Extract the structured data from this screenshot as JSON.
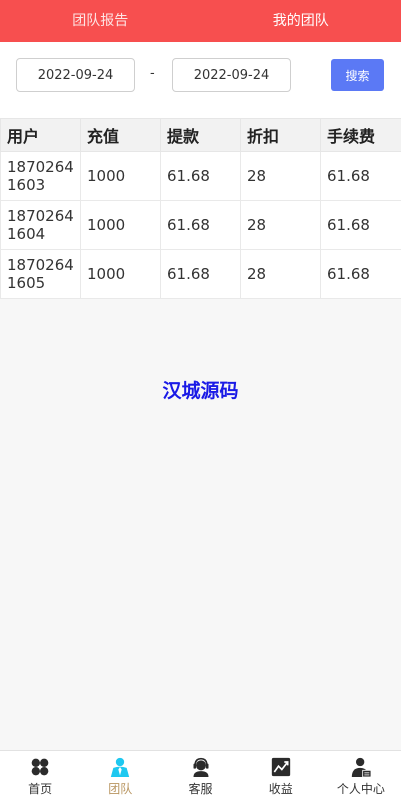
{
  "header": {
    "tabs": [
      {
        "label": "团队报告",
        "active": false
      },
      {
        "label": "我的团队",
        "active": true
      }
    ]
  },
  "filter": {
    "start_date": "2022-09-24",
    "separator": "-",
    "end_date": "2022-09-24",
    "search_label": "搜索"
  },
  "table": {
    "columns": [
      "用户",
      "充值",
      "提款",
      "折扣",
      "手续费"
    ],
    "rows": [
      [
        "18702641603",
        "1000",
        "61.68",
        "28",
        "61.68"
      ],
      [
        "18702641604",
        "1000",
        "61.68",
        "28",
        "61.68"
      ],
      [
        "18702641605",
        "1000",
        "61.68",
        "28",
        "61.68"
      ]
    ]
  },
  "watermark": "汉城源码",
  "bottom_nav": {
    "items": [
      {
        "label": "首页",
        "icon": "home-grid-icon",
        "active": false
      },
      {
        "label": "团队",
        "icon": "team-person-icon",
        "active": true
      },
      {
        "label": "客服",
        "icon": "support-headset-icon",
        "active": false
      },
      {
        "label": "收益",
        "icon": "earnings-chart-icon",
        "active": false
      },
      {
        "label": "个人中心",
        "icon": "profile-icon",
        "active": false
      }
    ]
  },
  "colors": {
    "header_bg": "#f74f4f",
    "search_button": "#5b79f5",
    "active_nav_icon": "#1ec8f0",
    "active_nav_label": "#b89560",
    "watermark": "#1a1ae6"
  }
}
